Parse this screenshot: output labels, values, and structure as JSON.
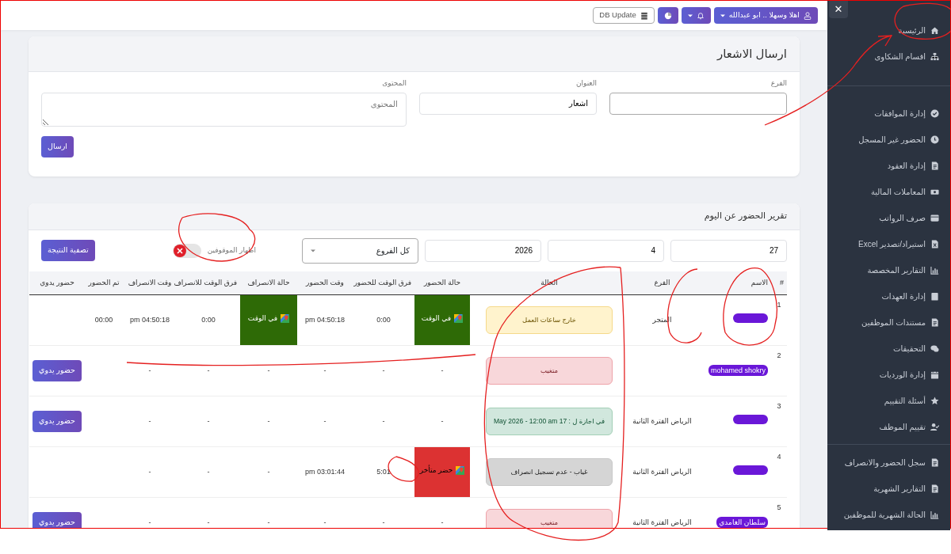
{
  "topbar": {
    "user_button": "اهلا وسهلا .. ابو عبدالله",
    "db_update": "DB Update"
  },
  "sidebar": {
    "close_label": "✕",
    "groups": [
      {
        "items": [
          {
            "label": "الرئيسية",
            "kind": "home"
          },
          {
            "label": "اقسام الشكاوى",
            "kind": "sitemap"
          }
        ]
      },
      {
        "items": [
          {
            "label": "إدارة الموافقات",
            "kind": "check"
          },
          {
            "label": "الحضور غير المسجل",
            "kind": "clock"
          },
          {
            "label": "إدارة العقود",
            "kind": "file"
          },
          {
            "label": "المعاملات المالية",
            "kind": "money"
          },
          {
            "label": "صرف الرواتب",
            "kind": "wallet"
          },
          {
            "label": "استيراد/تصدير Excel",
            "kind": "excel"
          },
          {
            "label": "التقارير المخصصة",
            "kind": "chart"
          },
          {
            "label": "إدارة العهدات",
            "kind": "box"
          },
          {
            "label": "مستندات الموظفين",
            "kind": "file"
          },
          {
            "label": "التحقيقات",
            "kind": "chat"
          },
          {
            "label": "إدارة الورديات",
            "kind": "calendar"
          },
          {
            "label": "أسئلة التقييم",
            "kind": "star"
          },
          {
            "label": "تقييم الموظف",
            "kind": "usercheck"
          }
        ]
      },
      {
        "items": [
          {
            "label": "سجل الحضور والانصراف",
            "kind": "file"
          },
          {
            "label": "التقارير الشهرية",
            "kind": "file"
          },
          {
            "label": "الحالة الشهرية للموظفين",
            "kind": "chart"
          }
        ]
      }
    ]
  },
  "notify_form": {
    "title": "ارسال الاشعار",
    "fields": [
      {
        "label": "الفرع",
        "kind": "select"
      },
      {
        "label": "العنوان",
        "kind": "input",
        "value": "اشعار"
      },
      {
        "label": "المحتوى",
        "kind": "textarea",
        "placeholder": "المحتوى"
      }
    ],
    "submit": "ارسال"
  },
  "report": {
    "title": "تقرير الحضور عن اليوم",
    "filters": {
      "day": "27",
      "month": "4",
      "year": "2026",
      "branch": "كل الفروع",
      "toggle": {
        "label": "اظهار الموقوفين",
        "on": false
      },
      "apply": "تصفية النتيجة"
    },
    "table": {
      "columns": [
        "#",
        "الاسم",
        "الفرع",
        "الحالة",
        "حالة الحضور",
        "فرق الوقت للحضور",
        "وقت الحضور",
        "حالة الانصراف",
        "فرق الوقت للانصراف",
        "وقت الانصراف",
        "تم الحضور",
        "حضور يدوي"
      ],
      "rows": [
        {
          "index": "1",
          "name_redacted": true,
          "branch": "المتجر",
          "status": {
            "text": "خارج ساعات العمل",
            "kind": "warning"
          },
          "arrival_status": {
            "text": "في الوقت",
            "kind": "ontime"
          },
          "arrival_diff": "0:00",
          "arrival_time": "pm 04:50:18",
          "leave_status": {
            "text": "في الوقت",
            "kind": "ontime"
          },
          "leave_diff": "0:00",
          "leave_time": "pm 04:50:18",
          "done": "00:00"
        },
        {
          "index": "2",
          "name": "mohamed shokry",
          "name_redacted": true,
          "status": {
            "text": "متغيب",
            "kind": "danger"
          },
          "arrival_status": {
            "text": "-"
          },
          "arrival_diff": "-",
          "arrival_time": "-",
          "leave_status": {
            "text": "-"
          },
          "leave_diff": "-",
          "leave_time": "-",
          "manual": "حضور يدوي"
        },
        {
          "index": "3",
          "name_redacted": true,
          "branch": "الرياض الفترة الثانية",
          "status": {
            "text": "في اجازة ل : 17 May 2026 - 12:00 am",
            "kind": "success"
          },
          "arrival_status": {
            "text": "-"
          },
          "arrival_diff": "-",
          "arrival_time": "-",
          "leave_status": {
            "text": "-"
          },
          "leave_diff": "-",
          "leave_time": "-",
          "manual": "حضور يدوي"
        },
        {
          "index": "4",
          "name_redacted": true,
          "branch": "الرياض الفترة الثانية",
          "status": {
            "text": "غياب - عدم تسجيل انصراف",
            "kind": "secondary"
          },
          "arrival_status": {
            "text": "حضر متأخر",
            "kind": "late"
          },
          "arrival_diff": "5:01",
          "arrival_time": "pm 03:01:44",
          "leave_status": {
            "text": "-"
          },
          "leave_diff": "-",
          "leave_time": "-"
        },
        {
          "index": "5",
          "name": "سلطان الغامدي",
          "name_redacted": true,
          "branch": "الرياض الفترة الثانية",
          "status": {
            "text": "متغيب",
            "kind": "danger"
          },
          "arrival_status": {
            "text": "-"
          },
          "arrival_diff": "-",
          "arrival_time": "-",
          "leave_status": {
            "text": "-"
          },
          "leave_diff": "-",
          "leave_time": "-",
          "manual": "حضور يدوي"
        }
      ]
    }
  }
}
